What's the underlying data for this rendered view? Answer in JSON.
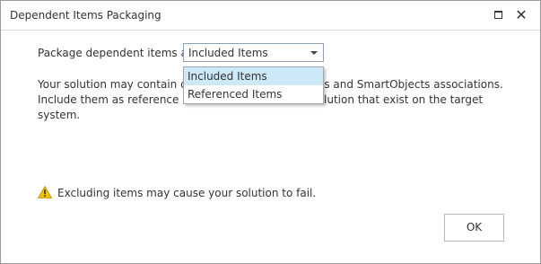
{
  "window": {
    "title": "Dependent Items Packaging",
    "maximize_icon": "maximize-icon",
    "close_glyph": "✕"
  },
  "form": {
    "package_label": "Package dependent items as",
    "select_value": "Included Items",
    "options": [
      "Included Items",
      "Referenced Items"
    ],
    "selected_index": 0
  },
  "description": {
    "line1_start": "Your solution may contain dep",
    "line1_end": "lists and SmartObjects associations.",
    "line2_start": "Include them as reference ite",
    "line2_end": "r solution that exist on the target",
    "line3": "system."
  },
  "warning": {
    "icon": "warning-icon",
    "text": "Excluding items may cause your solution to fail."
  },
  "buttons": {
    "ok_label": "OK"
  },
  "colors": {
    "selected_option_bg": "#cde8f6",
    "warning_yellow": "#f2c300"
  }
}
